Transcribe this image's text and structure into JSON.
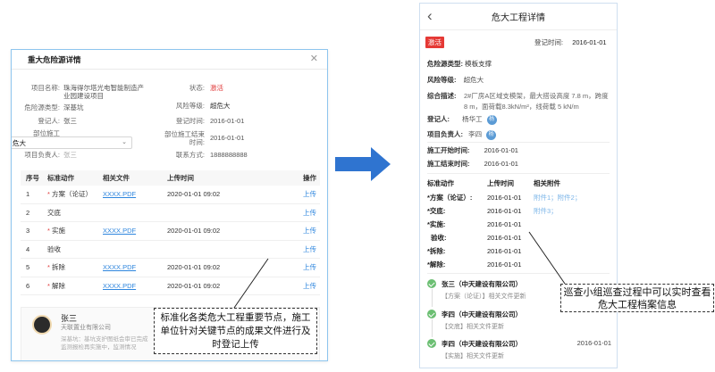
{
  "desktop": {
    "title": "重大危险源详情",
    "fields": {
      "project_name_label": "项目名称:",
      "project_name_value": "珠海得尔塔光电智能制造产业园建设项目",
      "hazard_type_label": "危险源类型:",
      "hazard_type_value": "深基坑",
      "registrant_label": "登记人:",
      "registrant_value": "张三",
      "unit_label": "部位施工",
      "unit_value": "2016-01-01",
      "owner_label": "项目负责人:",
      "owner_value": "张三",
      "status_label": "状态:",
      "status_value": "激活",
      "risk_label": "风险等级:",
      "risk_value": "超危大",
      "reg_time_label": "登记时间:",
      "reg_time_value": "2016-01-01",
      "end_label": "部位施工结束时间:",
      "end_value": "2016-01-01",
      "contact_label": "联系方式:",
      "contact_value": "1888888888"
    },
    "dropdown_value": "危大",
    "table": {
      "headers": [
        "序号",
        "标准动作",
        "相关文件",
        "上传时间",
        "操作"
      ],
      "rows": [
        {
          "no": "1",
          "star": "*",
          "action": "方案（论证）",
          "file": "XXXX.PDF",
          "time": "2020-01-01 09:02",
          "op": "上传"
        },
        {
          "no": "2",
          "star": "",
          "action": "交底",
          "file": "",
          "time": "",
          "op": "上传"
        },
        {
          "no": "3",
          "star": "*",
          "action": "实施",
          "file": "XXXX.PDF",
          "time": "2020-01-01 09:02",
          "op": "上传"
        },
        {
          "no": "4",
          "star": "",
          "action": "验收",
          "file": "",
          "time": "",
          "op": "上传"
        },
        {
          "no": "5",
          "star": "*",
          "action": "拆除",
          "file": "XXXX.PDF",
          "time": "2020-01-01 09:02",
          "op": "上传"
        },
        {
          "no": "6",
          "star": "*",
          "action": "解除",
          "file": "XXXX.PDF",
          "time": "2020-01-01 09:02",
          "op": "上传"
        }
      ]
    },
    "person": {
      "name": "张三",
      "company": "天联置业有限公司",
      "line1": "深基坑：基坑支护图纸会审已完成",
      "line2": "监测报检再实施中，监测情况"
    },
    "callout": "标准化各类危大工程重要节点，施工单位针对关键节点的成果文件进行及时登记上传"
  },
  "mobile": {
    "title": "危大工程详情",
    "badge": "激活",
    "reg_time_label": "登记时间:",
    "reg_time_value": "2016-01-01",
    "hazard_type_label": "危险源类型:",
    "hazard_type_value": "模板支撑",
    "risk_label": "风险等级:",
    "risk_value": "超危大",
    "desc_label": "综合描述:",
    "desc_value": "2#厂房A区域支模架，最大搭设高度 7.8 m，跨度 8 m，面荷载8.3kN/m²，线荷载 5 kN/m",
    "registrant_label": "登记人:",
    "registrant_value": "杨华工",
    "registrant_badge": "杨",
    "owner_label": "项目负责人:",
    "owner_value": "李四",
    "owner_badge": "杨",
    "start_label": "施工开始时间:",
    "start_value": "2016-01-01",
    "finish_label": "施工结束时间:",
    "finish_value": "2016-01-01",
    "steps_header": [
      "标准动作",
      "上传时间",
      "相关附件"
    ],
    "steps": [
      {
        "name": "*方案（论证）:",
        "time": "2016-01-01",
        "attach": "附件1；附件2；"
      },
      {
        "name": "*交底:",
        "time": "2016-01-01",
        "attach": "附件3；"
      },
      {
        "name": "*实施:",
        "time": "2016-01-01",
        "attach": ""
      },
      {
        "name": "验收:",
        "time": "2016-01-01",
        "attach": ""
      },
      {
        "name": "*拆除:",
        "time": "2016-01-01",
        "attach": ""
      },
      {
        "name": "*解除:",
        "time": "2016-01-01",
        "attach": ""
      }
    ],
    "logs": [
      {
        "who": "张三（中天建设有限公司）",
        "when": "",
        "act": "【方案（论证）】相关文件更新"
      },
      {
        "who": "李四（中天建设有限公司）",
        "when": "",
        "act": "【交底】相关文件更新"
      },
      {
        "who": "李四（中天建设有限公司）",
        "when": "2016-01-01",
        "act": "【实施】相关文件更新"
      }
    ],
    "callout": "巡查小组巡查过程中可以实时查看危大工程档案信息"
  },
  "colors": {
    "accent": "#2e86de",
    "danger": "#e03a3a",
    "success": "#6cbf73"
  }
}
